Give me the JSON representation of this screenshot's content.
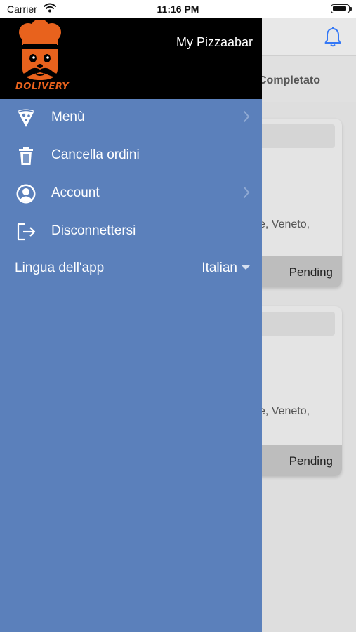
{
  "status_bar": {
    "carrier": "Carrier",
    "time": "11:16 PM"
  },
  "background": {
    "tab_label": "Completato",
    "orders": [
      {
        "address": "e,   Veneto,",
        "status": "Pending"
      },
      {
        "address": "e,   Veneto,",
        "status": "Pending"
      }
    ]
  },
  "drawer": {
    "logo_text": "DOLIVERY",
    "user_name": "My Pizzaabar",
    "items": [
      {
        "label": "Menù",
        "icon": "pizza-slice-icon"
      },
      {
        "label": "Cancella ordini",
        "icon": "trash-icon"
      },
      {
        "label": "Account",
        "icon": "user-circle-icon"
      },
      {
        "label": "Disconnettersi",
        "icon": "logout-icon"
      }
    ],
    "language": {
      "label": "Lingua dell'app",
      "value": "Italian"
    }
  },
  "colors": {
    "drawer_bg": "#5b80bb",
    "header_bg": "#000000",
    "brand_orange": "#e8621d"
  }
}
